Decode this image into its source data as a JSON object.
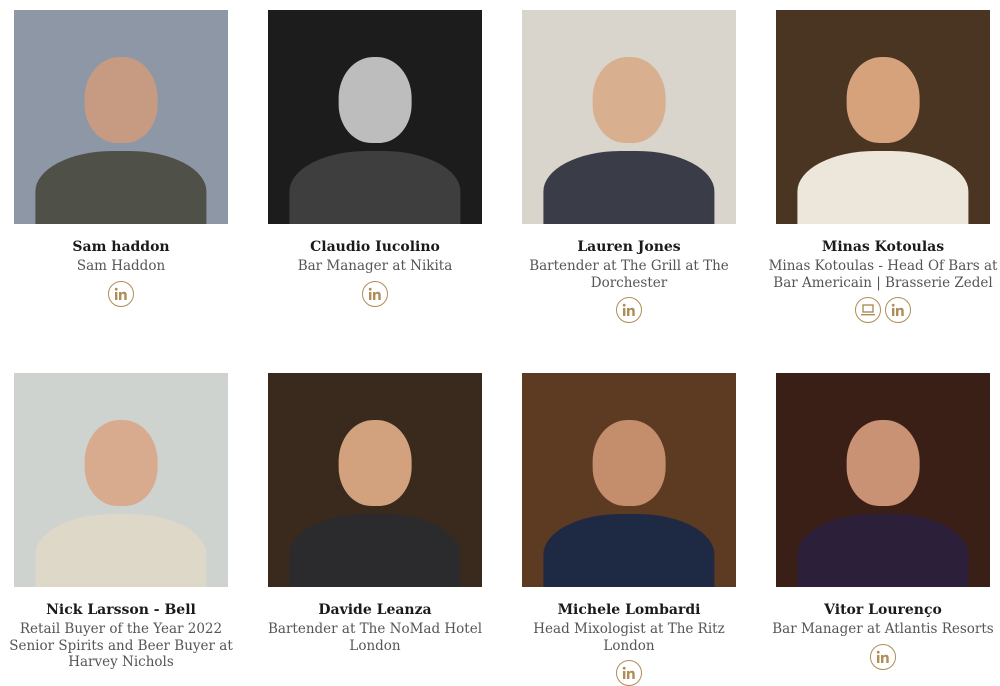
{
  "team": [
    {
      "name": "Sam haddon",
      "role": "Sam Haddon",
      "links": [
        "linkedin-icon"
      ],
      "bg": "#8e97a6",
      "head": "#c79b82",
      "torso": "#4f5048"
    },
    {
      "name": "Claudio Iucolino",
      "role": "Bar Manager at Nikita",
      "links": [
        "linkedin-icon"
      ],
      "bg": "#1c1c1c",
      "head": "#bdbdbd",
      "torso": "#3e3e3e"
    },
    {
      "name": "Lauren Jones",
      "role": "Bartender at The Grill at The Dorchester",
      "links": [
        "linkedin-icon"
      ],
      "bg": "#d9d4cc",
      "head": "#d8b090",
      "torso": "#3a3d48"
    },
    {
      "name": "Minas Kotoulas",
      "role": "Minas Kotoulas - Head Of Bars at Bar Americain | Brasserie Zedel",
      "links": [
        "laptop-icon",
        "linkedin-icon"
      ],
      "bg": "#4a3523",
      "head": "#d6a27c",
      "torso": "#ece7da"
    },
    {
      "name": "Nick Larsson - Bell",
      "role": "Retail Buyer of the Year 2022 Senior Spirits and Beer Buyer at Harvey Nichols",
      "links": [],
      "bg": "#cfd3d0",
      "head": "#d9ab8e",
      "torso": "#ddd8c7"
    },
    {
      "name": "Davide Leanza",
      "role": "Bartender at The NoMad Hotel London",
      "links": [],
      "bg": "#3a2a1d",
      "head": "#d2a17d",
      "torso": "#2b2b2d"
    },
    {
      "name": "Michele Lombardi",
      "role": "Head Mixologist at The Ritz London",
      "links": [
        "linkedin-icon"
      ],
      "bg": "#5d3a22",
      "head": "#c48d6b",
      "torso": "#1e2a44"
    },
    {
      "name": "Vitor Lourenço",
      "role": "Bar Manager at Atlantis Resorts",
      "links": [
        "linkedin-icon"
      ],
      "bg": "#3a1f16",
      "head": "#c99274",
      "torso": "#2c1f3a"
    }
  ],
  "accent": "#b08d57"
}
